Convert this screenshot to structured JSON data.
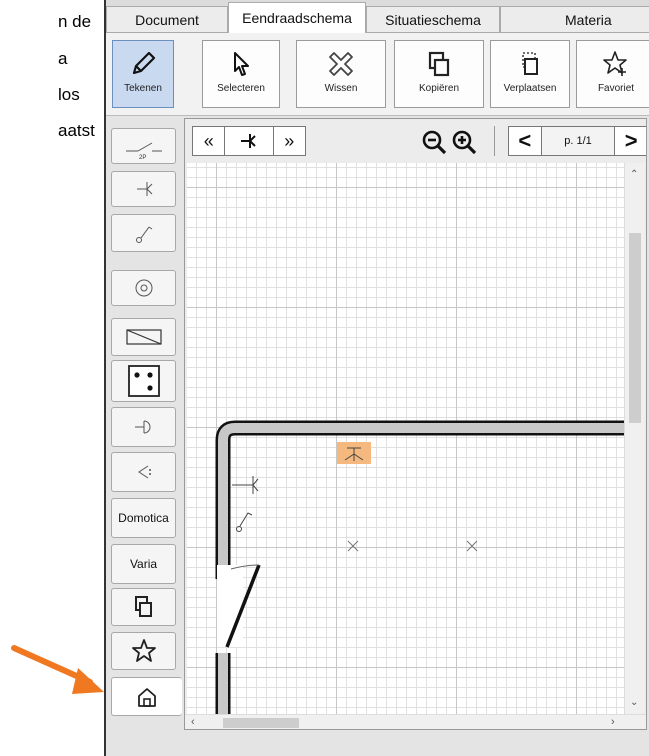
{
  "doc_text": [
    "n de",
    "a",
    "los",
    "aatst"
  ],
  "colors": {
    "annotation_arrow": "#f07820",
    "selected_symbol": "#f5b97f",
    "active_button": "#c9daf0",
    "wall": "#c8c8c8"
  },
  "tabs": [
    {
      "label": "Document",
      "active": false
    },
    {
      "label": "Eendraadschema",
      "active": true
    },
    {
      "label": "Situatieschema",
      "active": false
    },
    {
      "label": "Materia",
      "active": false
    }
  ],
  "toolbar": [
    {
      "label": "Tekenen",
      "icon": "pencil-icon",
      "active": true
    },
    {
      "label": "Selecteren",
      "icon": "cursor-icon",
      "active": false
    },
    {
      "label": "Wissen",
      "icon": "erase-icon",
      "active": false
    },
    {
      "label": "Kopiëren",
      "icon": "copy-icon",
      "active": false
    },
    {
      "label": "Verplaatsen",
      "icon": "move-icon",
      "active": false
    },
    {
      "label": "Favoriet",
      "icon": "star-plus-icon",
      "active": false
    }
  ],
  "sidebar": [
    {
      "icon": "two-pole-switch-icon",
      "text": "2P"
    },
    {
      "icon": "socket-symbol-icon"
    },
    {
      "icon": "switch-symbol-icon"
    },
    {
      "icon": "circle-symbol-icon"
    },
    {
      "icon": "diagonal-box-icon"
    },
    {
      "icon": "dice-icon"
    },
    {
      "icon": "plug-symbol-icon"
    },
    {
      "icon": "speaker-symbol-icon"
    },
    {
      "label": "Domotica"
    },
    {
      "label": "Varia"
    },
    {
      "icon": "copy-icon"
    },
    {
      "icon": "star-icon"
    },
    {
      "icon": "house-icon",
      "active": true
    }
  ],
  "canvas": {
    "prev_symbol": "«",
    "next_symbol": "»",
    "page_label": "p. 1/1",
    "page_prev": "<",
    "page_next": ">",
    "zoom_out_icon": "zoom-out-icon",
    "zoom_in_icon": "zoom-in-icon"
  }
}
